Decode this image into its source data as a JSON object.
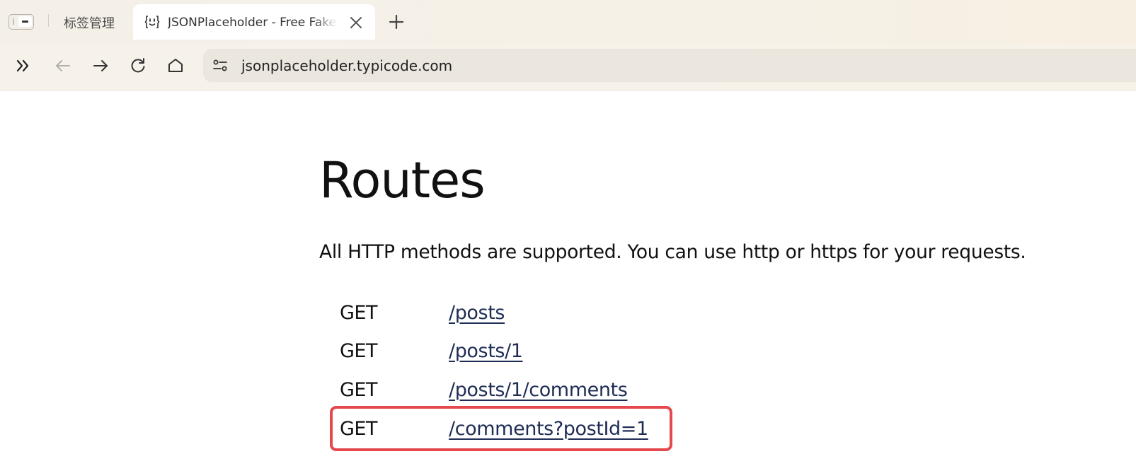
{
  "browser": {
    "tabs": [
      {
        "label": "标签管理",
        "active": false
      },
      {
        "label": "JSONPlaceholder - Free Fake REST API",
        "active": true,
        "favicon": "jsonplaceholder-face-icon"
      }
    ],
    "icons": {
      "sidebar_toggle": "sidebar-toggle-icon",
      "close_tab": "close-icon",
      "new_tab": "plus-icon",
      "expand": "double-chevron-right-icon",
      "back": "arrow-left-icon",
      "forward": "arrow-right-icon",
      "reload": "reload-icon",
      "home": "home-icon",
      "site_info": "site-settings-icon"
    },
    "url": "jsonplaceholder.typicode.com",
    "colors": {
      "chrome_bg": "#f6f2ea",
      "urlbar_bg": "#ebe7df",
      "highlight": "#e5484d",
      "link": "#1f2d55"
    }
  },
  "page": {
    "title": "Routes",
    "intro": "All HTTP methods are supported. You can use http or https for your requests.",
    "routes": [
      {
        "method": "GET",
        "path": "/posts"
      },
      {
        "method": "GET",
        "path": "/posts/1"
      },
      {
        "method": "GET",
        "path": "/posts/1/comments"
      },
      {
        "method": "GET",
        "path": "/comments?postId=1",
        "highlighted": true
      }
    ]
  }
}
